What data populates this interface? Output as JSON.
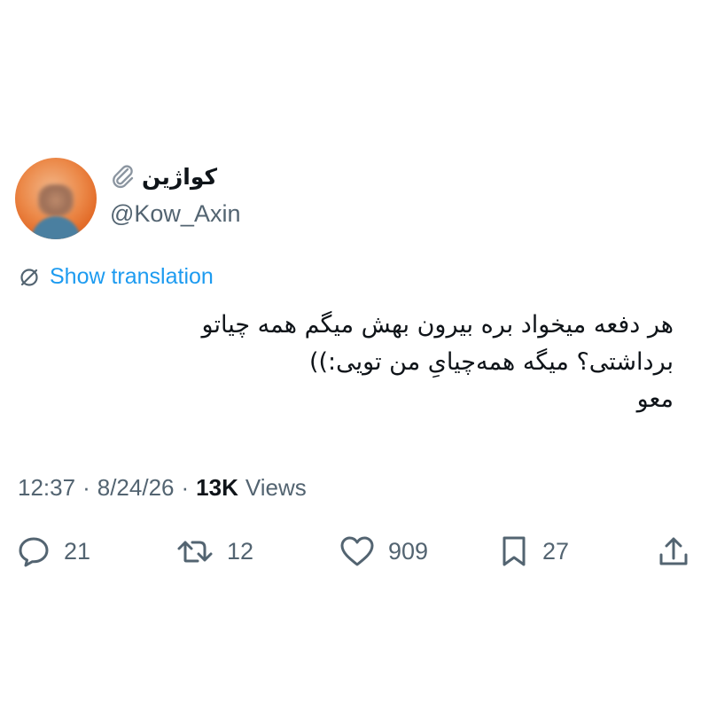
{
  "author": {
    "display_name": "کواژین",
    "handle": "@Kow_Axin"
  },
  "translate": {
    "label": "Show translation"
  },
  "tweet": {
    "lines": [
      "هر دفعه میخواد بره بیرون بهش میگم همه چیاتو",
      "برداشتی؟ میگه همه‌چیایِ من تویی:))",
      "معو"
    ]
  },
  "meta": {
    "time": "12:37",
    "separator": "·",
    "date": "8/24/26",
    "views_count": "13K",
    "views_label": "Views"
  },
  "actions": {
    "reply_count": "21",
    "retweet_count": "12",
    "like_count": "909",
    "bookmark_count": "27"
  },
  "icons": {
    "reply": "reply-icon",
    "retweet": "retweet-icon",
    "like": "heart-icon",
    "bookmark": "bookmark-icon",
    "share": "share-icon",
    "translate": "translate-icon",
    "emoji": "paperclip-icon"
  },
  "colors": {
    "link": "#1d9bf0",
    "secondary_text": "#536471",
    "primary_text": "#0f1419"
  }
}
